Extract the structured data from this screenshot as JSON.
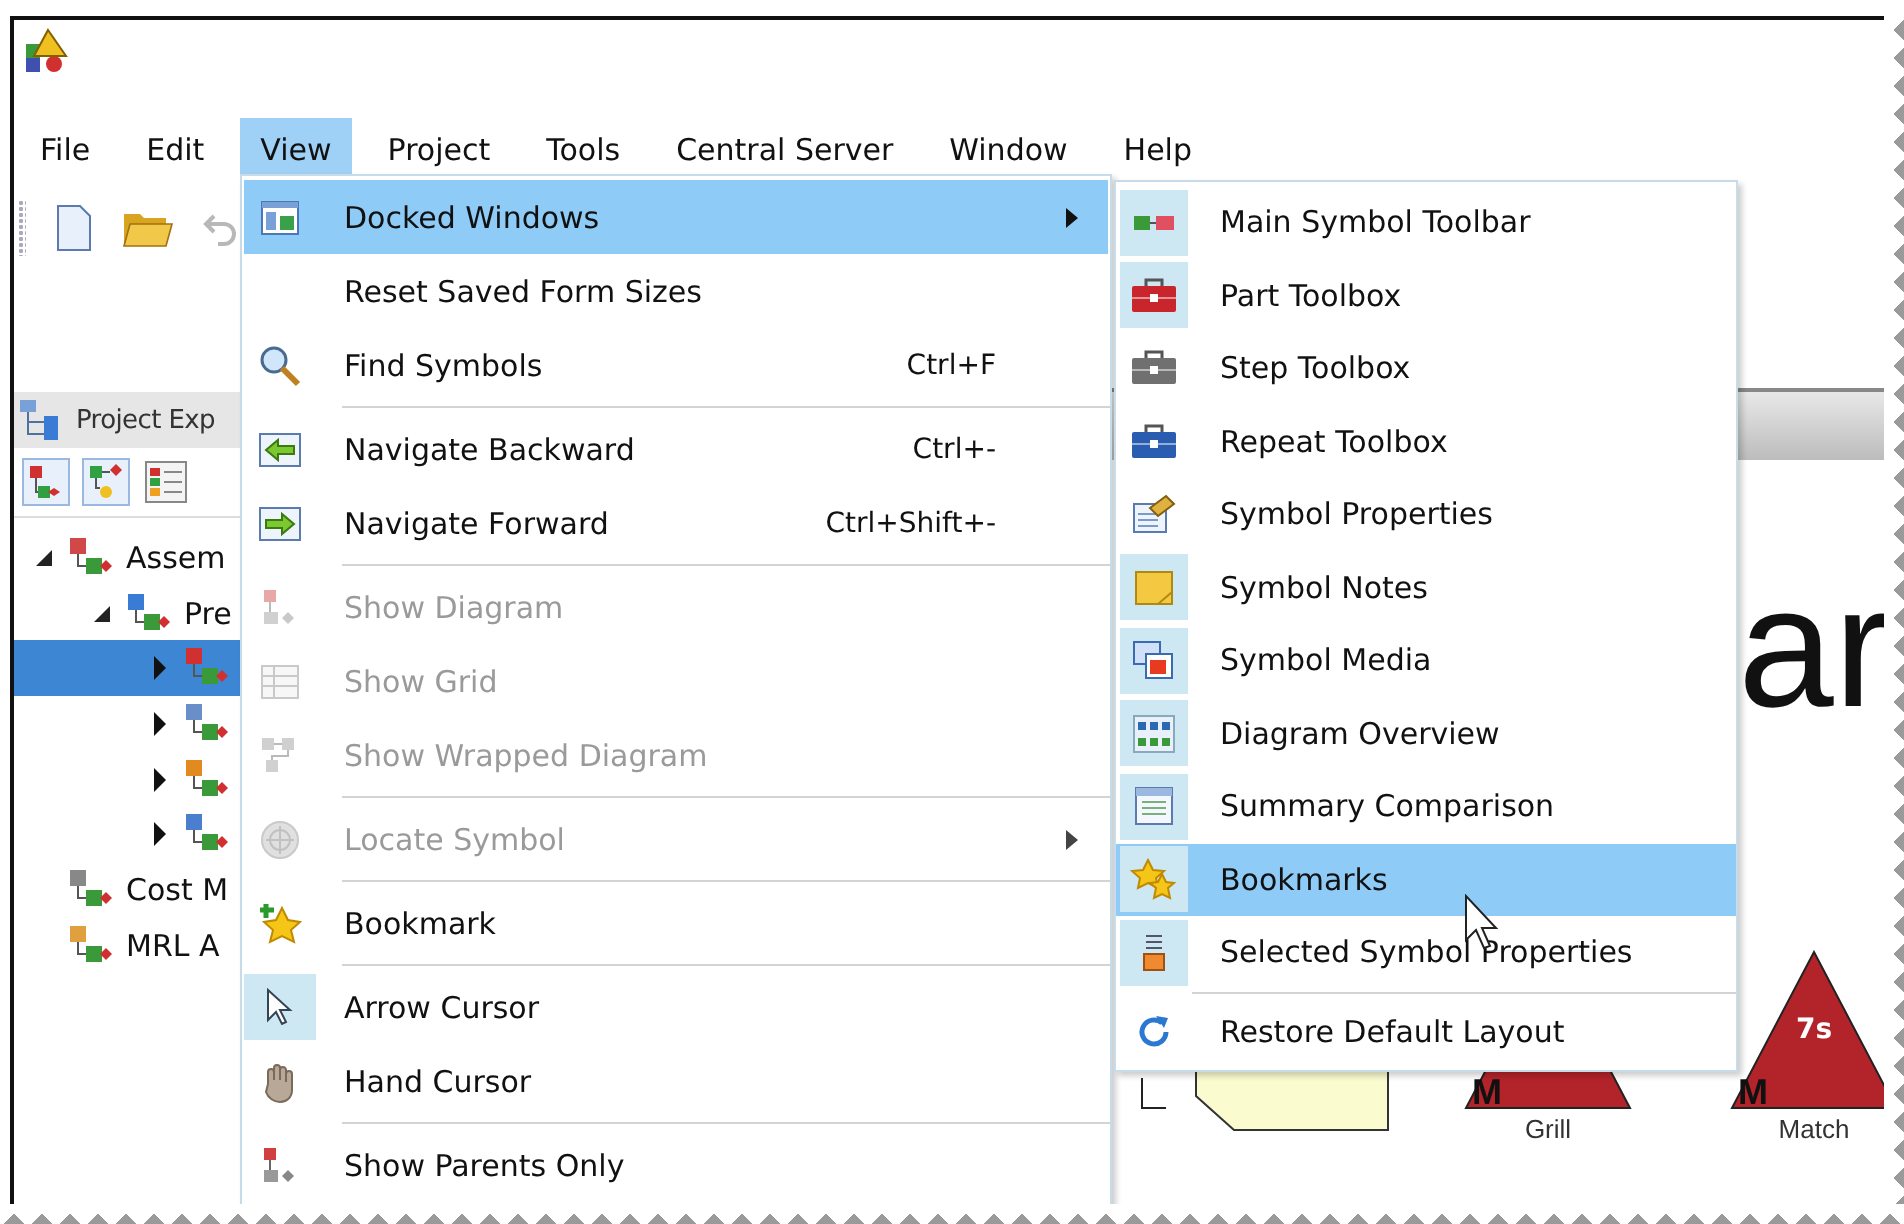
{
  "menu_bar": [
    {
      "label": "File",
      "selected": false
    },
    {
      "label": "Edit",
      "selected": false
    },
    {
      "label": "View",
      "selected": true
    },
    {
      "label": "Project",
      "selected": false
    },
    {
      "label": "Tools",
      "selected": false
    },
    {
      "label": "Central Server",
      "selected": false
    },
    {
      "label": "Window",
      "selected": false
    },
    {
      "label": "Help",
      "selected": false
    }
  ],
  "project_explorer": {
    "title": "Project Exp",
    "tree": [
      {
        "label": "Assem",
        "kind": "assembly",
        "expanded": true,
        "selected": false,
        "children": [
          {
            "label": "Pre",
            "kind": "grid",
            "expanded": true,
            "selected": false,
            "children": [
              {
                "kind": "diagram",
                "expanded": false,
                "selected": true
              },
              {
                "kind": "media",
                "expanded": false,
                "selected": false
              },
              {
                "kind": "steps",
                "expanded": false,
                "selected": false
              },
              {
                "kind": "report",
                "expanded": false,
                "selected": false
              }
            ]
          }
        ]
      },
      {
        "label": "Cost M",
        "kind": "cost",
        "selected": false
      },
      {
        "label": "MRL A",
        "kind": "checklist",
        "selected": false
      }
    ]
  },
  "view_menu": {
    "items": [
      {
        "kind": "item",
        "label": "Docked Windows",
        "submenu": true,
        "selected": true,
        "disabled": false,
        "checked": false
      },
      {
        "kind": "item",
        "label": "Reset Saved Form Sizes",
        "submenu": false,
        "selected": false,
        "disabled": false,
        "checked": false
      },
      {
        "kind": "item",
        "label": "Find Symbols",
        "shortcut": "Ctrl+F",
        "submenu": false,
        "selected": false,
        "disabled": false,
        "checked": false
      },
      {
        "kind": "separator"
      },
      {
        "kind": "item",
        "label": "Navigate Backward",
        "shortcut": "Ctrl+-",
        "submenu": false,
        "selected": false,
        "disabled": false,
        "checked": false
      },
      {
        "kind": "item",
        "label": "Navigate Forward",
        "shortcut": "Ctrl+Shift+-",
        "submenu": false,
        "selected": false,
        "disabled": false,
        "checked": false
      },
      {
        "kind": "separator"
      },
      {
        "kind": "item",
        "label": "Show Diagram",
        "submenu": false,
        "selected": false,
        "disabled": true,
        "checked": false
      },
      {
        "kind": "item",
        "label": "Show Grid",
        "submenu": false,
        "selected": false,
        "disabled": true,
        "checked": false
      },
      {
        "kind": "item",
        "label": "Show Wrapped Diagram",
        "submenu": false,
        "selected": false,
        "disabled": true,
        "checked": false
      },
      {
        "kind": "separator"
      },
      {
        "kind": "item",
        "label": "Locate Symbol",
        "submenu": true,
        "selected": false,
        "disabled": true,
        "checked": false
      },
      {
        "kind": "separator"
      },
      {
        "kind": "item",
        "label": "Bookmark",
        "submenu": false,
        "selected": false,
        "disabled": false,
        "checked": false
      },
      {
        "kind": "separator"
      },
      {
        "kind": "item",
        "label": "Arrow Cursor",
        "submenu": false,
        "selected": false,
        "disabled": false,
        "checked": true
      },
      {
        "kind": "item",
        "label": "Hand Cursor",
        "submenu": false,
        "selected": false,
        "disabled": false,
        "checked": false
      },
      {
        "kind": "separator"
      },
      {
        "kind": "item",
        "label": "Show Parents Only",
        "submenu": false,
        "selected": false,
        "disabled": false,
        "checked": false
      }
    ]
  },
  "docked_windows_menu": {
    "items": [
      {
        "kind": "item",
        "label": "Main Symbol Toolbar",
        "checked": true,
        "selected": false
      },
      {
        "kind": "item",
        "label": "Part Toolbox",
        "checked": true,
        "selected": false
      },
      {
        "kind": "item",
        "label": "Step Toolbox",
        "checked": false,
        "selected": false
      },
      {
        "kind": "item",
        "label": "Repeat Toolbox",
        "checked": false,
        "selected": false
      },
      {
        "kind": "item",
        "label": "Symbol Properties",
        "checked": false,
        "selected": false
      },
      {
        "kind": "item",
        "label": "Symbol Notes",
        "checked": true,
        "selected": false
      },
      {
        "kind": "item",
        "label": "Symbol Media",
        "checked": true,
        "selected": false
      },
      {
        "kind": "item",
        "label": "Diagram Overview",
        "checked": true,
        "selected": false
      },
      {
        "kind": "item",
        "label": "Summary Comparison",
        "checked": true,
        "selected": false
      },
      {
        "kind": "item",
        "label": "Bookmarks",
        "checked": true,
        "selected": true
      },
      {
        "kind": "item",
        "label": "Selected Symbol Properties",
        "checked": true,
        "selected": false
      },
      {
        "kind": "separator"
      },
      {
        "kind": "item",
        "label": "Restore Default Layout",
        "checked": false,
        "selected": false
      }
    ]
  },
  "diagram": {
    "title": "ar",
    "symbols": [
      {
        "label": "Grill",
        "marker": "M"
      },
      {
        "label": "Match",
        "marker": "M",
        "badge": "7s"
      }
    ]
  }
}
